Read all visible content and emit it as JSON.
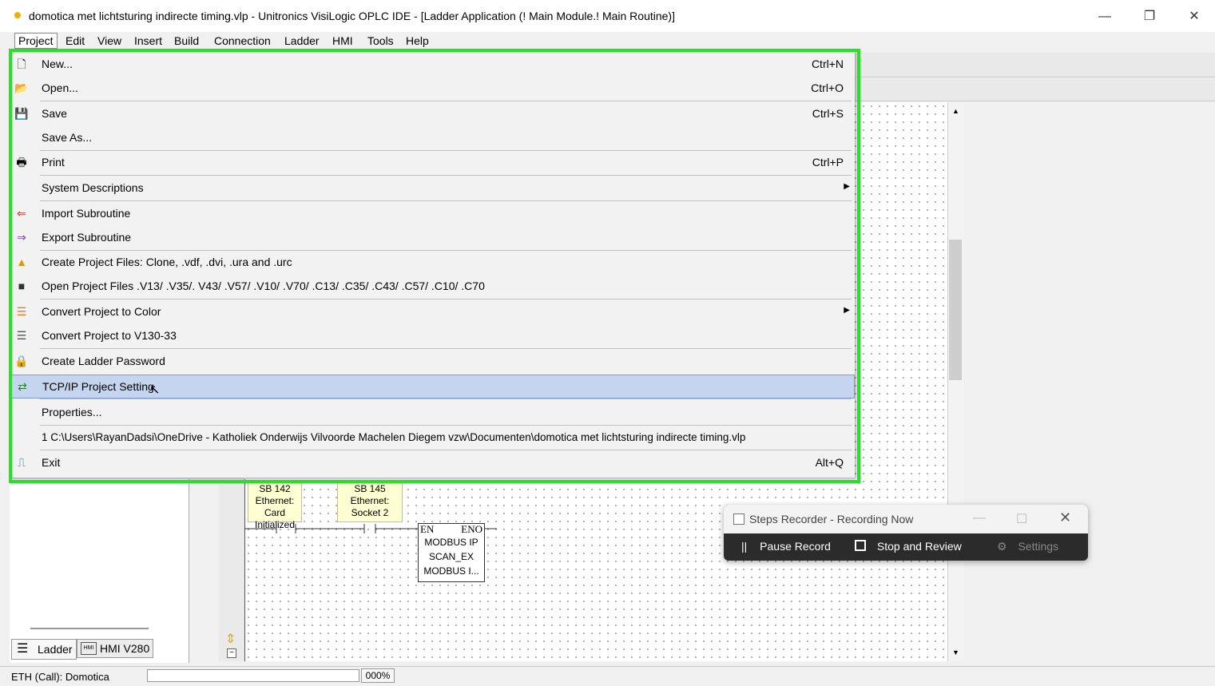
{
  "window": {
    "title": "domotica met lichtsturing indirecte timing.vlp - Unitronics VisiLogic OPLC IDE - [Ladder Application (! Main Module.! Main Routine)]",
    "minimize": "—",
    "restore": "❐",
    "close": "✕"
  },
  "menubar": [
    "Project",
    "Edit",
    "View",
    "Insert",
    "Build",
    "Connection",
    "Ladder",
    "HMI",
    "Tools",
    "Help"
  ],
  "dropdown": {
    "items": [
      {
        "label": "New...",
        "shortcut": "Ctrl+N",
        "icon": "new-file-icon"
      },
      {
        "label": "Open...",
        "shortcut": "Ctrl+O",
        "icon": "open-folder-icon"
      },
      {
        "label": "Save",
        "shortcut": "Ctrl+S",
        "icon": "save-disk-icon"
      },
      {
        "label": "Save As...",
        "shortcut": "",
        "icon": ""
      },
      {
        "label": "Print",
        "shortcut": "Ctrl+P",
        "icon": "printer-icon"
      },
      {
        "label": "System Descriptions",
        "shortcut": "",
        "icon": ""
      },
      {
        "label": "Import Subroutine",
        "shortcut": "",
        "icon": "import-icon"
      },
      {
        "label": "Export Subroutine",
        "shortcut": "",
        "icon": "export-icon"
      },
      {
        "label": "Create Project Files: Clone, .vdf, .dvi, .ura and .urc",
        "shortcut": "",
        "icon": "clone-icon"
      },
      {
        "label": "Open Project Files .V13/ .V35/. V43/ .V57/ .V10/ .V70/  .C13/ .C35/ .C43/ .C57/ .C10/ .C70",
        "shortcut": "",
        "icon": "open-project-icon"
      },
      {
        "label": "Convert Project to Color",
        "shortcut": "",
        "icon": "color-convert-icon"
      },
      {
        "label": "Convert Project to V130-33",
        "shortcut": "",
        "icon": "v130-convert-icon"
      },
      {
        "label": "Create Ladder Password",
        "shortcut": "",
        "icon": "password-icon"
      },
      {
        "label": "TCP/IP Project Setting",
        "shortcut": "",
        "icon": "network-icon"
      },
      {
        "label": "Properties...",
        "shortcut": "",
        "icon": ""
      },
      {
        "label": "1 C:\\Users\\RayanDadsi\\OneDrive - Katholiek Onderwijs Vilvoorde Machelen Diegem vzw\\Documenten\\domotica met lichtsturing indirecte timing.vlp",
        "shortcut": "",
        "icon": ""
      },
      {
        "label": "Exit",
        "shortcut": "Alt+Q",
        "icon": "exit-icon"
      }
    ]
  },
  "ladder": {
    "sb142": [
      "SB 142",
      "Ethernet: Card",
      "Initialized"
    ],
    "sb145": [
      "SB 145",
      "Ethernet:",
      "Socket 2"
    ],
    "fb": {
      "en": "EN",
      "eno": "ENO",
      "l1": "MODBUS IP",
      "l2": "SCAN_EX",
      "l3": "MODBUS I..."
    }
  },
  "lefttabs": {
    "ladder": "Ladder",
    "hmi": "HMI V280",
    "hmi_icon_text": "HMI"
  },
  "status": {
    "connection": "ETH (Call): Domotica",
    "zoom": "000%"
  },
  "steps_recorder": {
    "title": "Steps Recorder - Recording Now",
    "pause": "Pause Record",
    "stop": "Stop and Review",
    "settings": "Settings"
  }
}
